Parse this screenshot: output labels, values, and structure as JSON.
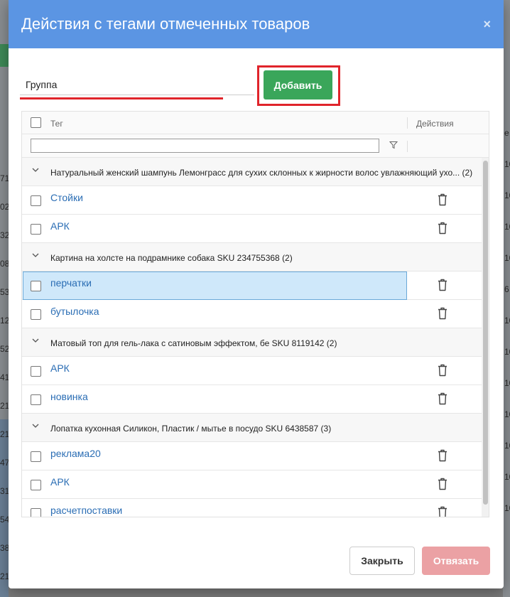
{
  "background": {
    "left_numbers": [
      "71",
      "02",
      "32",
      "08",
      "53",
      "12",
      "52",
      "41",
      "21",
      "21",
      "47",
      "31",
      "54",
      "38",
      "21"
    ],
    "right_numbers": [
      "e",
      "10",
      "10",
      "10",
      "10",
      "6",
      "10",
      "10",
      "10",
      "10",
      "10",
      "10",
      "10"
    ]
  },
  "modal": {
    "title": "Действия с тегами отмеченных товаров",
    "close_glyph": "×"
  },
  "tag_input": {
    "value": "Группа"
  },
  "add_button": {
    "label": "Добавить"
  },
  "grid": {
    "columns": {
      "tag": "Тег",
      "actions": "Действия"
    },
    "filter_icon": "filter-icon",
    "groups": [
      {
        "title": "Натуральный женский шампунь Лемонграсс для сухих склонных к жирности волос увлажняющий ухо... (2)",
        "tags": [
          {
            "label": "Стойки",
            "selected": false
          },
          {
            "label": "АРК",
            "selected": false
          }
        ]
      },
      {
        "title": "Картина на холсте на подрамнике собака SKU 234755368 (2)",
        "tags": [
          {
            "label": "перчатки",
            "selected": true
          },
          {
            "label": "бутылочка",
            "selected": false
          }
        ]
      },
      {
        "title": "Матовый топ для гель-лака с сатиновым эффектом, бе SKU 8119142 (2)",
        "tags": [
          {
            "label": "АРК",
            "selected": false
          },
          {
            "label": "новинка",
            "selected": false
          }
        ]
      },
      {
        "title": "Лопатка кухонная Силикон, Пластик / мытье в посудо SKU 6438587 (3)",
        "tags": [
          {
            "label": "реклама20",
            "selected": false
          },
          {
            "label": "АРК",
            "selected": false
          },
          {
            "label": "расчетпоставки",
            "selected": false
          }
        ]
      }
    ]
  },
  "footer": {
    "close_label": "Закрыть",
    "unbind_label": "Отвязать"
  },
  "colors": {
    "header": "#5b95e3",
    "add_button": "#3aa65a",
    "highlight_frame": "#e0242b",
    "link": "#2a6db4",
    "selected_row": "#cfe8fa",
    "unbind_button": "#eba1a4"
  }
}
